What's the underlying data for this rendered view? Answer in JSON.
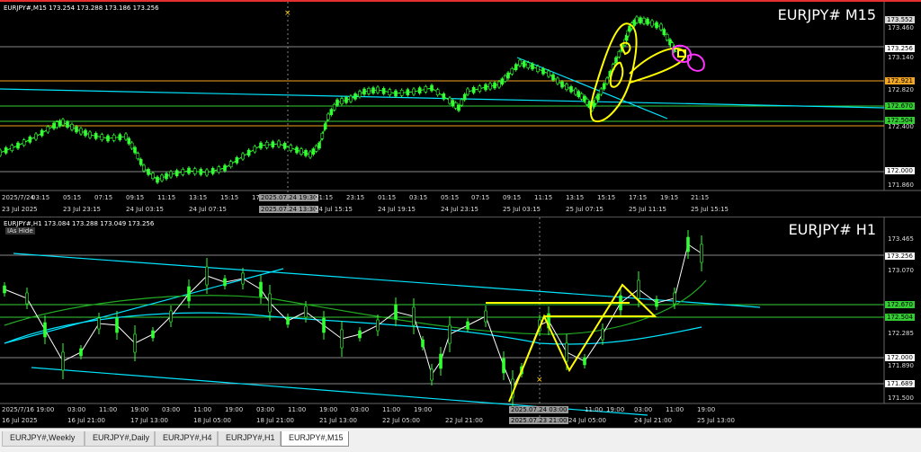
{
  "top": {
    "info": "EURJPY#,M15  173.254 173.288 173.186 173.256",
    "title": "EURJPY# M15",
    "price_labels": [
      "173.460",
      "173.140",
      "172.820",
      "172.400",
      "171.860"
    ],
    "badges": [
      {
        "text": "173.552",
        "bg": "#d8d8d8",
        "fg": "#000"
      },
      {
        "text": "173.256",
        "bg": "#ffffff",
        "fg": "#000"
      },
      {
        "text": "172.921",
        "bg": "#f5a623",
        "fg": "#000"
      },
      {
        "text": "172.670",
        "bg": "#33cc33",
        "fg": "#000"
      },
      {
        "text": "172.504",
        "bg": "#33cc33",
        "fg": "#000"
      },
      {
        "text": "172.000",
        "bg": "#ffffff",
        "fg": "#000"
      }
    ],
    "x_labels": [
      "2025/7/24",
      "03:15",
      "05:15",
      "07:15",
      "09:15",
      "11:15",
      "13:15",
      "15:15",
      "17",
      "2025.07.24 19:30",
      "21:15",
      "23:15",
      "01:15",
      "03:15",
      "05:15",
      "07:15",
      "09:15",
      "11:15",
      "13:15",
      "15:15",
      "17:15",
      "19:15",
      "21:15"
    ],
    "x_labels2": [
      "23 Jul 2025",
      "23 Jul 23:15",
      "24 Jul 03:15",
      "24 Jul 07:15",
      "2025.07.24 13:30",
      "24 Jul 15:15",
      "24 Jul 19:15",
      "24 Jul 23:15",
      "25 Jul 03:15",
      "25 Jul 07:15",
      "25 Jul 11:15",
      "25 Jul 15:15"
    ]
  },
  "bottom": {
    "info": "EURJPY#,H1  173.084 173.288 173.049 173.256",
    "hide": "IAs Hide",
    "title": "EURJPY# H1",
    "price_labels": [
      "173.465",
      "173.070",
      "172.285",
      "171.890",
      "171.500"
    ],
    "badges": [
      {
        "text": "173.256",
        "bg": "#ffffff",
        "fg": "#000"
      },
      {
        "text": "172.670",
        "bg": "#33cc33",
        "fg": "#000"
      },
      {
        "text": "172.504",
        "bg": "#33cc33",
        "fg": "#000"
      },
      {
        "text": "172.000",
        "bg": "#ffffff",
        "fg": "#000"
      },
      {
        "text": "171.689",
        "bg": "#ffffff",
        "fg": "#000"
      }
    ],
    "x_labels": [
      "2025/7/16 19:00",
      "03:00",
      "11:00",
      "19:00",
      "03:00",
      "11:00",
      "19:00",
      "03:00",
      "11:00",
      "19:00",
      "03:00",
      "11:00",
      "19:00",
      "2025.07.24 03:00",
      "11:00",
      "19:00",
      "03:00",
      "11:00",
      "19:00"
    ],
    "x_labels2": [
      "16 Jul 2025",
      "16 Jul 21:00",
      "17 Jul 13:00",
      "18 Jul 05:00",
      "18 Jul 21:00",
      "21 Jul 13:00",
      "22 Jul 05:00",
      "22 Jul 21:00",
      "2025.07.23 21:00",
      "24 Jul 05:00",
      "24 Jul 21:00",
      "25 Jul 13:00"
    ]
  },
  "tabs": [
    "EURJPY#,Weekly",
    "EURJPY#,Daily",
    "EURJPY#,H4",
    "EURJPY#,H1",
    "EURJPY#,M15"
  ],
  "colors": {
    "up": "#33ff33",
    "line": "#00e5ff",
    "level_green": "#33cc33",
    "level_orange": "#f5a623",
    "draw_yellow": "#ffff00",
    "draw_magenta": "#ff33ff"
  }
}
